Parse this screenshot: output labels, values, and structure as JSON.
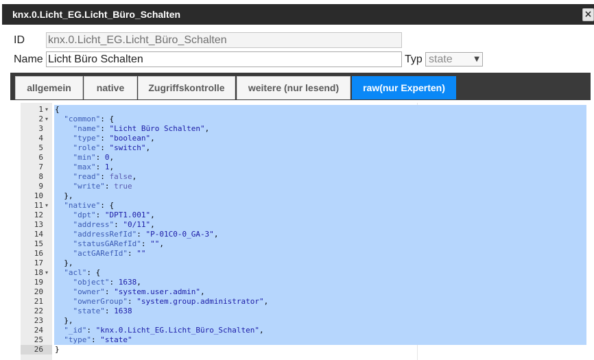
{
  "dialog": {
    "title": "knx.0.Licht_EG.Licht_Büro_Schalten",
    "close_glyph": "×"
  },
  "form": {
    "id_label": "ID",
    "id_value": "knx.0.Licht_EG.Licht_Büro_Schalten",
    "name_label": "Name",
    "name_value": "Licht Büro Schalten",
    "type_label": "Typ",
    "type_value": "state"
  },
  "tabs": [
    {
      "label": "allgemein",
      "active": false
    },
    {
      "label": "native",
      "active": false
    },
    {
      "label": "Zugriffskontrolle",
      "active": false
    },
    {
      "label": "weitere (nur lesend)",
      "active": false
    },
    {
      "label": "raw(nur Experten)",
      "active": true
    }
  ],
  "editor": {
    "lines": [
      [
        {
          "t": "{",
          "c": "p"
        }
      ],
      [
        {
          "t": "  ",
          "c": "p"
        },
        {
          "t": "\"common\"",
          "c": "k"
        },
        {
          "t": ": {",
          "c": "p"
        }
      ],
      [
        {
          "t": "    ",
          "c": "p"
        },
        {
          "t": "\"name\"",
          "c": "k"
        },
        {
          "t": ": ",
          "c": "p"
        },
        {
          "t": "\"Licht Büro Schalten\"",
          "c": "s"
        },
        {
          "t": ",",
          "c": "p"
        }
      ],
      [
        {
          "t": "    ",
          "c": "p"
        },
        {
          "t": "\"type\"",
          "c": "k"
        },
        {
          "t": ": ",
          "c": "p"
        },
        {
          "t": "\"boolean\"",
          "c": "s"
        },
        {
          "t": ",",
          "c": "p"
        }
      ],
      [
        {
          "t": "    ",
          "c": "p"
        },
        {
          "t": "\"role\"",
          "c": "k"
        },
        {
          "t": ": ",
          "c": "p"
        },
        {
          "t": "\"switch\"",
          "c": "s"
        },
        {
          "t": ",",
          "c": "p"
        }
      ],
      [
        {
          "t": "    ",
          "c": "p"
        },
        {
          "t": "\"min\"",
          "c": "k"
        },
        {
          "t": ": ",
          "c": "p"
        },
        {
          "t": "0",
          "c": "n"
        },
        {
          "t": ",",
          "c": "p"
        }
      ],
      [
        {
          "t": "    ",
          "c": "p"
        },
        {
          "t": "\"max\"",
          "c": "k"
        },
        {
          "t": ": ",
          "c": "p"
        },
        {
          "t": "1",
          "c": "n"
        },
        {
          "t": ",",
          "c": "p"
        }
      ],
      [
        {
          "t": "    ",
          "c": "p"
        },
        {
          "t": "\"read\"",
          "c": "k"
        },
        {
          "t": ": ",
          "c": "p"
        },
        {
          "t": "false",
          "c": "b"
        },
        {
          "t": ",",
          "c": "p"
        }
      ],
      [
        {
          "t": "    ",
          "c": "p"
        },
        {
          "t": "\"write\"",
          "c": "k"
        },
        {
          "t": ": ",
          "c": "p"
        },
        {
          "t": "true",
          "c": "b"
        }
      ],
      [
        {
          "t": "  },",
          "c": "p"
        }
      ],
      [
        {
          "t": "  ",
          "c": "p"
        },
        {
          "t": "\"native\"",
          "c": "k"
        },
        {
          "t": ": {",
          "c": "p"
        }
      ],
      [
        {
          "t": "    ",
          "c": "p"
        },
        {
          "t": "\"dpt\"",
          "c": "k"
        },
        {
          "t": ": ",
          "c": "p"
        },
        {
          "t": "\"DPT1.001\"",
          "c": "s"
        },
        {
          "t": ",",
          "c": "p"
        }
      ],
      [
        {
          "t": "    ",
          "c": "p"
        },
        {
          "t": "\"address\"",
          "c": "k"
        },
        {
          "t": ": ",
          "c": "p"
        },
        {
          "t": "\"0/11\"",
          "c": "s"
        },
        {
          "t": ",",
          "c": "p"
        }
      ],
      [
        {
          "t": "    ",
          "c": "p"
        },
        {
          "t": "\"addressRefId\"",
          "c": "k"
        },
        {
          "t": ": ",
          "c": "p"
        },
        {
          "t": "\"P-01C0-0_GA-3\"",
          "c": "s"
        },
        {
          "t": ",",
          "c": "p"
        }
      ],
      [
        {
          "t": "    ",
          "c": "p"
        },
        {
          "t": "\"statusGARefId\"",
          "c": "k"
        },
        {
          "t": ": ",
          "c": "p"
        },
        {
          "t": "\"\"",
          "c": "s"
        },
        {
          "t": ",",
          "c": "p"
        }
      ],
      [
        {
          "t": "    ",
          "c": "p"
        },
        {
          "t": "\"actGARefId\"",
          "c": "k"
        },
        {
          "t": ": ",
          "c": "p"
        },
        {
          "t": "\"\"",
          "c": "s"
        }
      ],
      [
        {
          "t": "  },",
          "c": "p"
        }
      ],
      [
        {
          "t": "  ",
          "c": "p"
        },
        {
          "t": "\"acl\"",
          "c": "k"
        },
        {
          "t": ": {",
          "c": "p"
        }
      ],
      [
        {
          "t": "    ",
          "c": "p"
        },
        {
          "t": "\"object\"",
          "c": "k"
        },
        {
          "t": ": ",
          "c": "p"
        },
        {
          "t": "1638",
          "c": "n"
        },
        {
          "t": ",",
          "c": "p"
        }
      ],
      [
        {
          "t": "    ",
          "c": "p"
        },
        {
          "t": "\"owner\"",
          "c": "k"
        },
        {
          "t": ": ",
          "c": "p"
        },
        {
          "t": "\"system.user.admin\"",
          "c": "s"
        },
        {
          "t": ",",
          "c": "p"
        }
      ],
      [
        {
          "t": "    ",
          "c": "p"
        },
        {
          "t": "\"ownerGroup\"",
          "c": "k"
        },
        {
          "t": ": ",
          "c": "p"
        },
        {
          "t": "\"system.group.administrator\"",
          "c": "s"
        },
        {
          "t": ",",
          "c": "p"
        }
      ],
      [
        {
          "t": "    ",
          "c": "p"
        },
        {
          "t": "\"state\"",
          "c": "k"
        },
        {
          "t": ": ",
          "c": "p"
        },
        {
          "t": "1638",
          "c": "n"
        }
      ],
      [
        {
          "t": "  },",
          "c": "p"
        }
      ],
      [
        {
          "t": "  ",
          "c": "p"
        },
        {
          "t": "\"_id\"",
          "c": "k"
        },
        {
          "t": ": ",
          "c": "p"
        },
        {
          "t": "\"knx.0.Licht_EG.Licht_Büro_Schalten\"",
          "c": "s"
        },
        {
          "t": ",",
          "c": "p"
        }
      ],
      [
        {
          "t": "  ",
          "c": "p"
        },
        {
          "t": "\"type\"",
          "c": "k"
        },
        {
          "t": ": ",
          "c": "p"
        },
        {
          "t": "\"state\"",
          "c": "s"
        }
      ],
      [
        {
          "t": "}",
          "c": "p"
        }
      ]
    ],
    "fold_lines": [
      1,
      2,
      11,
      18
    ],
    "fold_glyph": "▾"
  },
  "colors": {
    "selection": "#b6d6fd",
    "active_tab": "#0a88f7",
    "titlebar": "#2b2b2b"
  }
}
